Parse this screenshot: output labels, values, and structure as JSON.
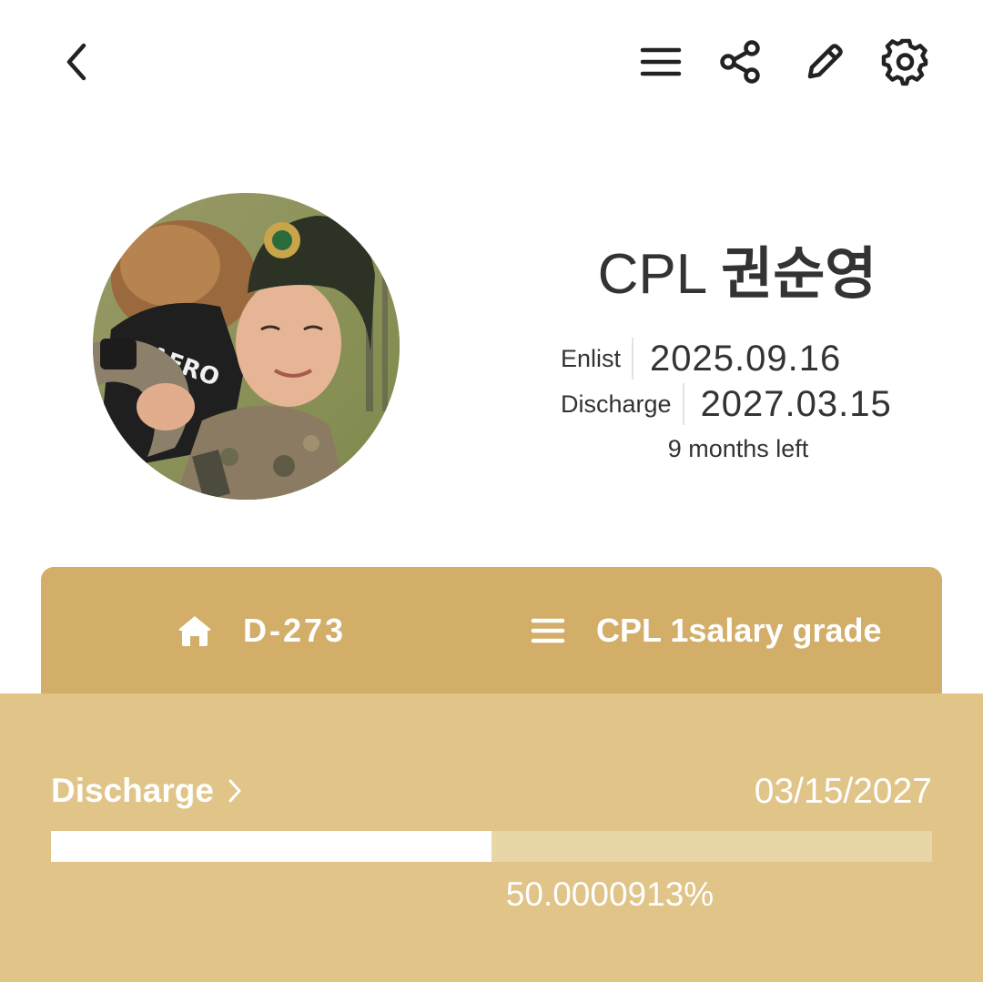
{
  "icons": {
    "back": "chevron-left-icon",
    "menu": "hamburger-menu-icon",
    "share": "share-icon",
    "edit": "pencil-icon",
    "settings": "gear-icon",
    "home": "home-icon",
    "list": "list-icon",
    "chevron": "chevron-right-icon"
  },
  "profile": {
    "rank": "CPL",
    "name": "권순영",
    "enlist_label": "Enlist",
    "enlist_date": "2025.09.16",
    "discharge_label": "Discharge",
    "discharge_date": "2027.03.15",
    "remaining": "9 months left"
  },
  "tabs": {
    "dday": "D-273",
    "grade": "CPL 1salary grade"
  },
  "discharge_progress": {
    "title": "Discharge",
    "date": "03/15/2027",
    "percent_text": "50.0000913%",
    "fraction": 0.500000913
  },
  "colors": {
    "tab_bar": "#d2ae69",
    "panel": "#e0c488",
    "progress_track": "#e9d6a6",
    "progress_fill": "#ffffff"
  }
}
